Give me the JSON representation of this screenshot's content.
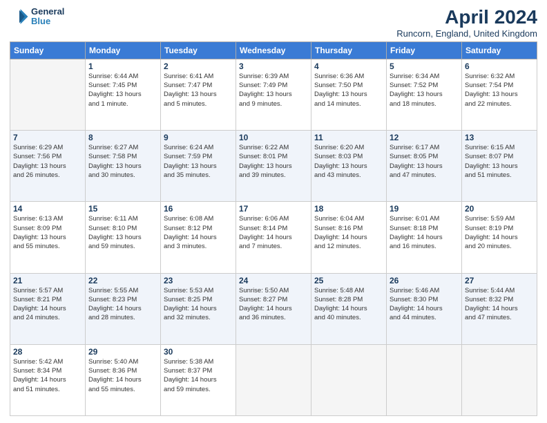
{
  "header": {
    "logo_line1": "General",
    "logo_line2": "Blue",
    "month_year": "April 2024",
    "location": "Runcorn, England, United Kingdom"
  },
  "days_of_week": [
    "Sunday",
    "Monday",
    "Tuesday",
    "Wednesday",
    "Thursday",
    "Friday",
    "Saturday"
  ],
  "weeks": [
    [
      {
        "day": "",
        "info": ""
      },
      {
        "day": "1",
        "info": "Sunrise: 6:44 AM\nSunset: 7:45 PM\nDaylight: 13 hours\nand 1 minute."
      },
      {
        "day": "2",
        "info": "Sunrise: 6:41 AM\nSunset: 7:47 PM\nDaylight: 13 hours\nand 5 minutes."
      },
      {
        "day": "3",
        "info": "Sunrise: 6:39 AM\nSunset: 7:49 PM\nDaylight: 13 hours\nand 9 minutes."
      },
      {
        "day": "4",
        "info": "Sunrise: 6:36 AM\nSunset: 7:50 PM\nDaylight: 13 hours\nand 14 minutes."
      },
      {
        "day": "5",
        "info": "Sunrise: 6:34 AM\nSunset: 7:52 PM\nDaylight: 13 hours\nand 18 minutes."
      },
      {
        "day": "6",
        "info": "Sunrise: 6:32 AM\nSunset: 7:54 PM\nDaylight: 13 hours\nand 22 minutes."
      }
    ],
    [
      {
        "day": "7",
        "info": "Sunrise: 6:29 AM\nSunset: 7:56 PM\nDaylight: 13 hours\nand 26 minutes."
      },
      {
        "day": "8",
        "info": "Sunrise: 6:27 AM\nSunset: 7:58 PM\nDaylight: 13 hours\nand 30 minutes."
      },
      {
        "day": "9",
        "info": "Sunrise: 6:24 AM\nSunset: 7:59 PM\nDaylight: 13 hours\nand 35 minutes."
      },
      {
        "day": "10",
        "info": "Sunrise: 6:22 AM\nSunset: 8:01 PM\nDaylight: 13 hours\nand 39 minutes."
      },
      {
        "day": "11",
        "info": "Sunrise: 6:20 AM\nSunset: 8:03 PM\nDaylight: 13 hours\nand 43 minutes."
      },
      {
        "day": "12",
        "info": "Sunrise: 6:17 AM\nSunset: 8:05 PM\nDaylight: 13 hours\nand 47 minutes."
      },
      {
        "day": "13",
        "info": "Sunrise: 6:15 AM\nSunset: 8:07 PM\nDaylight: 13 hours\nand 51 minutes."
      }
    ],
    [
      {
        "day": "14",
        "info": "Sunrise: 6:13 AM\nSunset: 8:09 PM\nDaylight: 13 hours\nand 55 minutes."
      },
      {
        "day": "15",
        "info": "Sunrise: 6:11 AM\nSunset: 8:10 PM\nDaylight: 13 hours\nand 59 minutes."
      },
      {
        "day": "16",
        "info": "Sunrise: 6:08 AM\nSunset: 8:12 PM\nDaylight: 14 hours\nand 3 minutes."
      },
      {
        "day": "17",
        "info": "Sunrise: 6:06 AM\nSunset: 8:14 PM\nDaylight: 14 hours\nand 7 minutes."
      },
      {
        "day": "18",
        "info": "Sunrise: 6:04 AM\nSunset: 8:16 PM\nDaylight: 14 hours\nand 12 minutes."
      },
      {
        "day": "19",
        "info": "Sunrise: 6:01 AM\nSunset: 8:18 PM\nDaylight: 14 hours\nand 16 minutes."
      },
      {
        "day": "20",
        "info": "Sunrise: 5:59 AM\nSunset: 8:19 PM\nDaylight: 14 hours\nand 20 minutes."
      }
    ],
    [
      {
        "day": "21",
        "info": "Sunrise: 5:57 AM\nSunset: 8:21 PM\nDaylight: 14 hours\nand 24 minutes."
      },
      {
        "day": "22",
        "info": "Sunrise: 5:55 AM\nSunset: 8:23 PM\nDaylight: 14 hours\nand 28 minutes."
      },
      {
        "day": "23",
        "info": "Sunrise: 5:53 AM\nSunset: 8:25 PM\nDaylight: 14 hours\nand 32 minutes."
      },
      {
        "day": "24",
        "info": "Sunrise: 5:50 AM\nSunset: 8:27 PM\nDaylight: 14 hours\nand 36 minutes."
      },
      {
        "day": "25",
        "info": "Sunrise: 5:48 AM\nSunset: 8:28 PM\nDaylight: 14 hours\nand 40 minutes."
      },
      {
        "day": "26",
        "info": "Sunrise: 5:46 AM\nSunset: 8:30 PM\nDaylight: 14 hours\nand 44 minutes."
      },
      {
        "day": "27",
        "info": "Sunrise: 5:44 AM\nSunset: 8:32 PM\nDaylight: 14 hours\nand 47 minutes."
      }
    ],
    [
      {
        "day": "28",
        "info": "Sunrise: 5:42 AM\nSunset: 8:34 PM\nDaylight: 14 hours\nand 51 minutes."
      },
      {
        "day": "29",
        "info": "Sunrise: 5:40 AM\nSunset: 8:36 PM\nDaylight: 14 hours\nand 55 minutes."
      },
      {
        "day": "30",
        "info": "Sunrise: 5:38 AM\nSunset: 8:37 PM\nDaylight: 14 hours\nand 59 minutes."
      },
      {
        "day": "",
        "info": ""
      },
      {
        "day": "",
        "info": ""
      },
      {
        "day": "",
        "info": ""
      },
      {
        "day": "",
        "info": ""
      }
    ]
  ]
}
